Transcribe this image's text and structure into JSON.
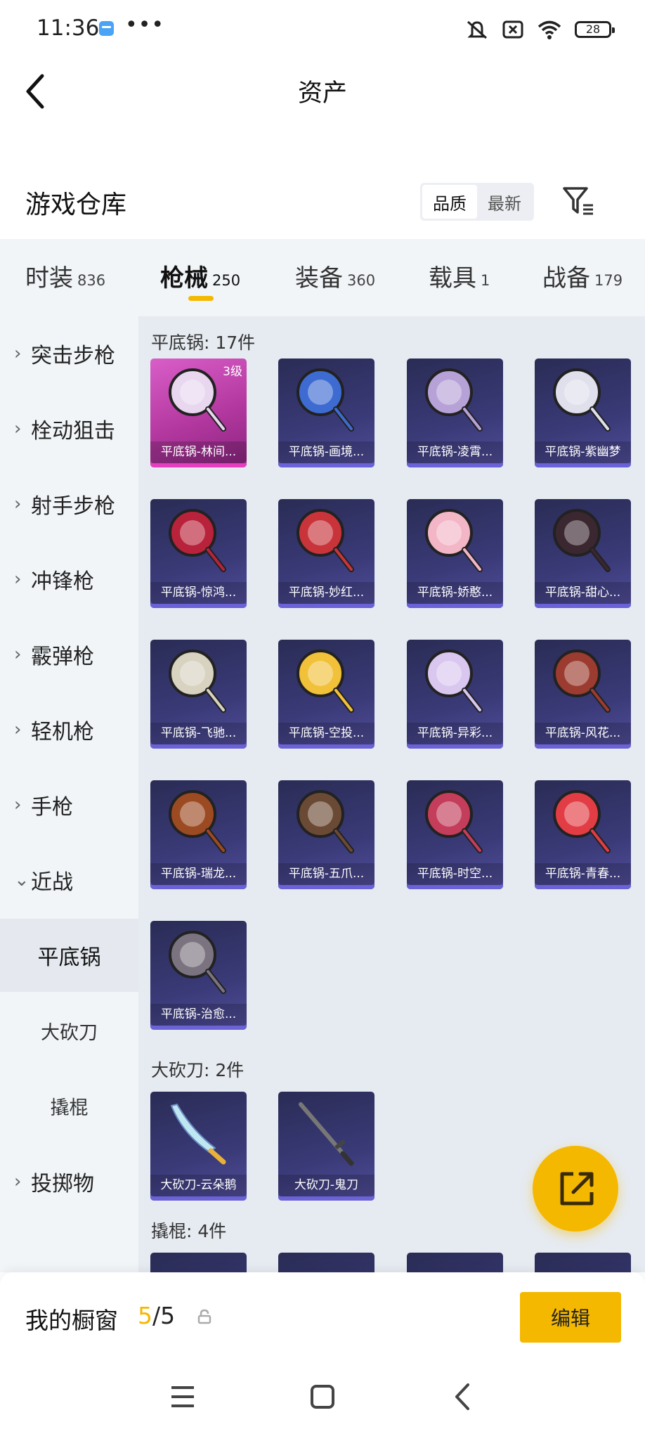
{
  "status_bar": {
    "time": "11:36",
    "dots": "•••",
    "battery": "28"
  },
  "header": {
    "title": "资产"
  },
  "warehouse": {
    "title": "游戏仓库",
    "sort_options": [
      "品质",
      "最新"
    ]
  },
  "tabs": [
    {
      "label": "时装",
      "count": "836"
    },
    {
      "label": "枪械",
      "count": "250"
    },
    {
      "label": "装备",
      "count": "360"
    },
    {
      "label": "载具",
      "count": "1"
    },
    {
      "label": "战备",
      "count": "179"
    }
  ],
  "sidebar": {
    "items": [
      "突击步枪",
      "栓动狙击",
      "射手步枪",
      "冲锋枪",
      "霰弹枪",
      "轻机枪",
      "手枪",
      "近战",
      "投掷物"
    ],
    "subitems": [
      "平底锅",
      "大砍刀",
      "撬棍"
    ]
  },
  "groups": [
    {
      "title": "平底锅: 17件",
      "items": [
        "平底锅-林间...",
        "平底锅-画境...",
        "平底锅-凌霄...",
        "平底锅-紫幽梦",
        "平底锅-惊鸿...",
        "平底锅-妙红...",
        "平底锅-娇憨...",
        "平底锅-甜心...",
        "平底锅-飞驰...",
        "平底锅-空投...",
        "平底锅-异彩...",
        "平底锅-风花...",
        "平底锅-瑞龙...",
        "平底锅-五爪...",
        "平底锅-时空...",
        "平底锅-青春...",
        "平底锅-治愈..."
      ],
      "first_level": "3级"
    },
    {
      "title": "大砍刀: 2件",
      "items": [
        "大砍刀-云朵鹅",
        "大砍刀-鬼刀"
      ]
    },
    {
      "title": "撬棍: 4件"
    }
  ],
  "showcase": {
    "title": "我的橱窗",
    "used": "5",
    "total": "/5",
    "edit_label": "编辑"
  },
  "colors": {
    "accent": "#f5b800",
    "card_bg": "#2f3060",
    "card_pink": "#c94bb8",
    "sidebar_bg": "#f1f5f8"
  }
}
